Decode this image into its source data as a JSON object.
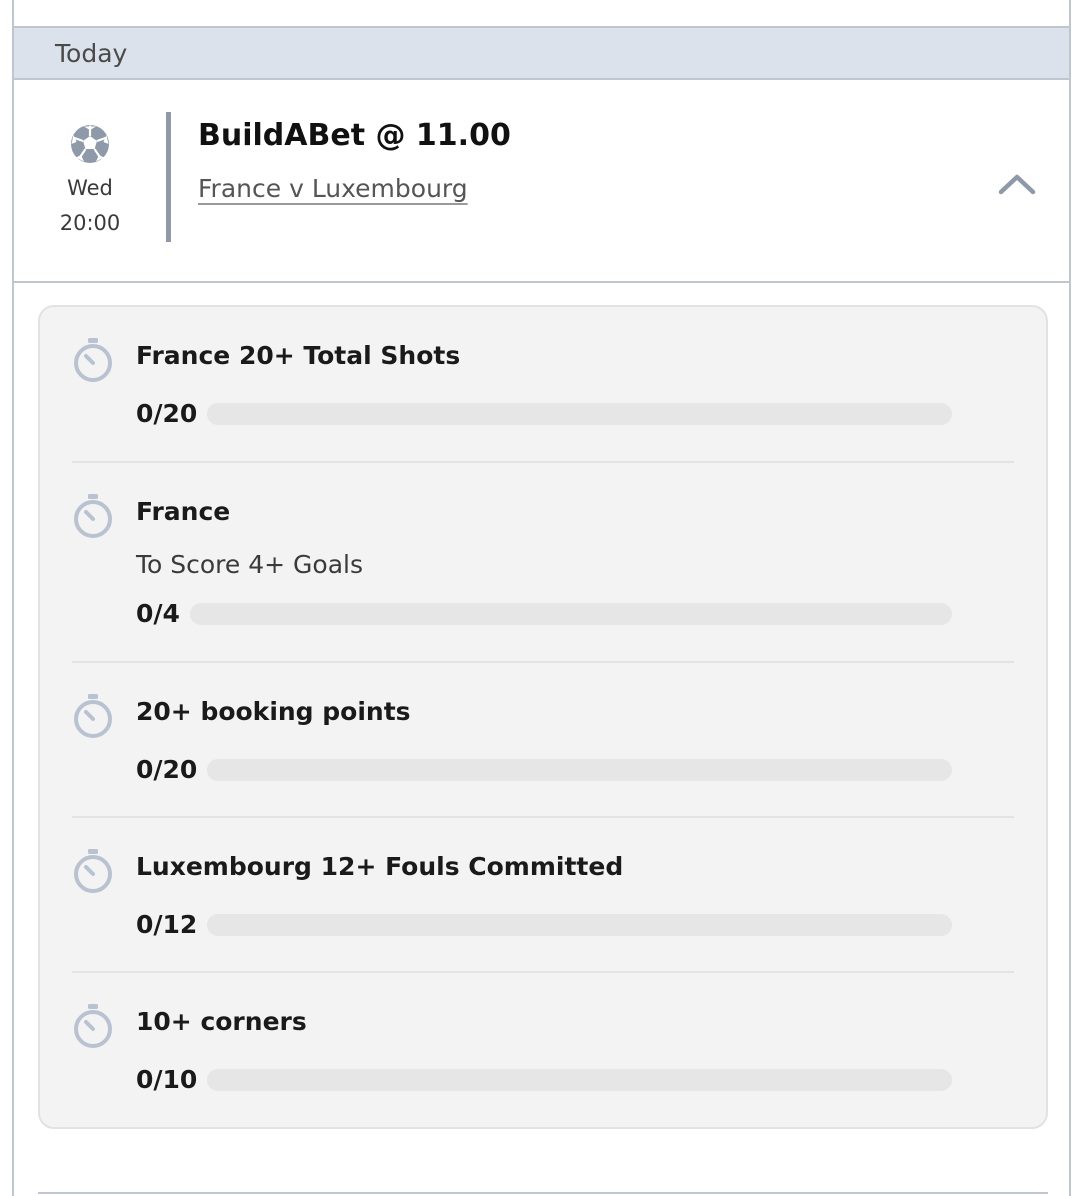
{
  "day_header": {
    "label": "Today"
  },
  "event": {
    "sport_icon": "football-icon",
    "day": "Wed",
    "time": "20:00",
    "title": "BuildABet @ 11.00",
    "match": "France v Luxembourg",
    "toggle_icon": "chevron-up-icon"
  },
  "legs": [
    {
      "title": "France 20+ Total Shots",
      "subtitle": "",
      "progress_text": "0/20",
      "progress": 0,
      "icon": "timer-icon"
    },
    {
      "title": "France",
      "subtitle": "To Score 4+ Goals",
      "progress_text": "0/4",
      "progress": 0,
      "icon": "timer-icon"
    },
    {
      "title": "20+ booking points",
      "subtitle": "",
      "progress_text": "0/20",
      "progress": 0,
      "icon": "timer-icon"
    },
    {
      "title": "Luxembourg 12+ Fouls Committed",
      "subtitle": "",
      "progress_text": "0/12",
      "progress": 0,
      "icon": "timer-icon"
    },
    {
      "title": "10+ corners",
      "subtitle": "",
      "progress_text": "0/10",
      "progress": 0,
      "icon": "timer-icon"
    }
  ],
  "colors": {
    "header_bg": "#dce2eb",
    "border": "#bfc6d0",
    "divider": "#8f99a8",
    "card_bg": "#f3f3f3",
    "track": "#e6e6e6",
    "icon": "#b8c2d0"
  }
}
